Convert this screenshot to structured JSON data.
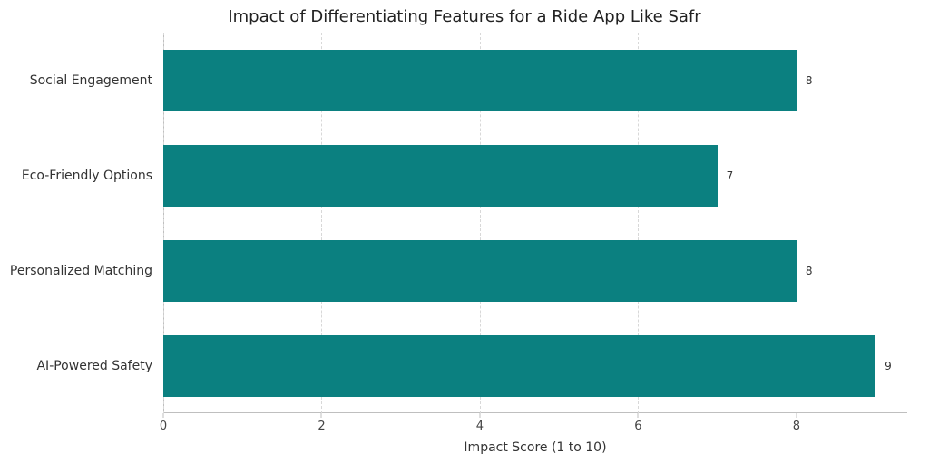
{
  "chart_data": {
    "type": "bar",
    "orientation": "horizontal",
    "title": "Impact of Differentiating Features for a Ride App Like Safr",
    "xlabel": "Impact Score (1 to 10)",
    "ylabel": "",
    "xlim": [
      0,
      9.4
    ],
    "xticks": [
      0,
      2,
      4,
      6,
      8
    ],
    "categories": [
      "Social Engagement",
      "Eco-Friendly Options",
      "Personalized Matching",
      "AI-Powered Safety"
    ],
    "values": [
      8,
      7,
      8,
      9
    ],
    "bar_color": "#0b8080",
    "grid": true
  }
}
